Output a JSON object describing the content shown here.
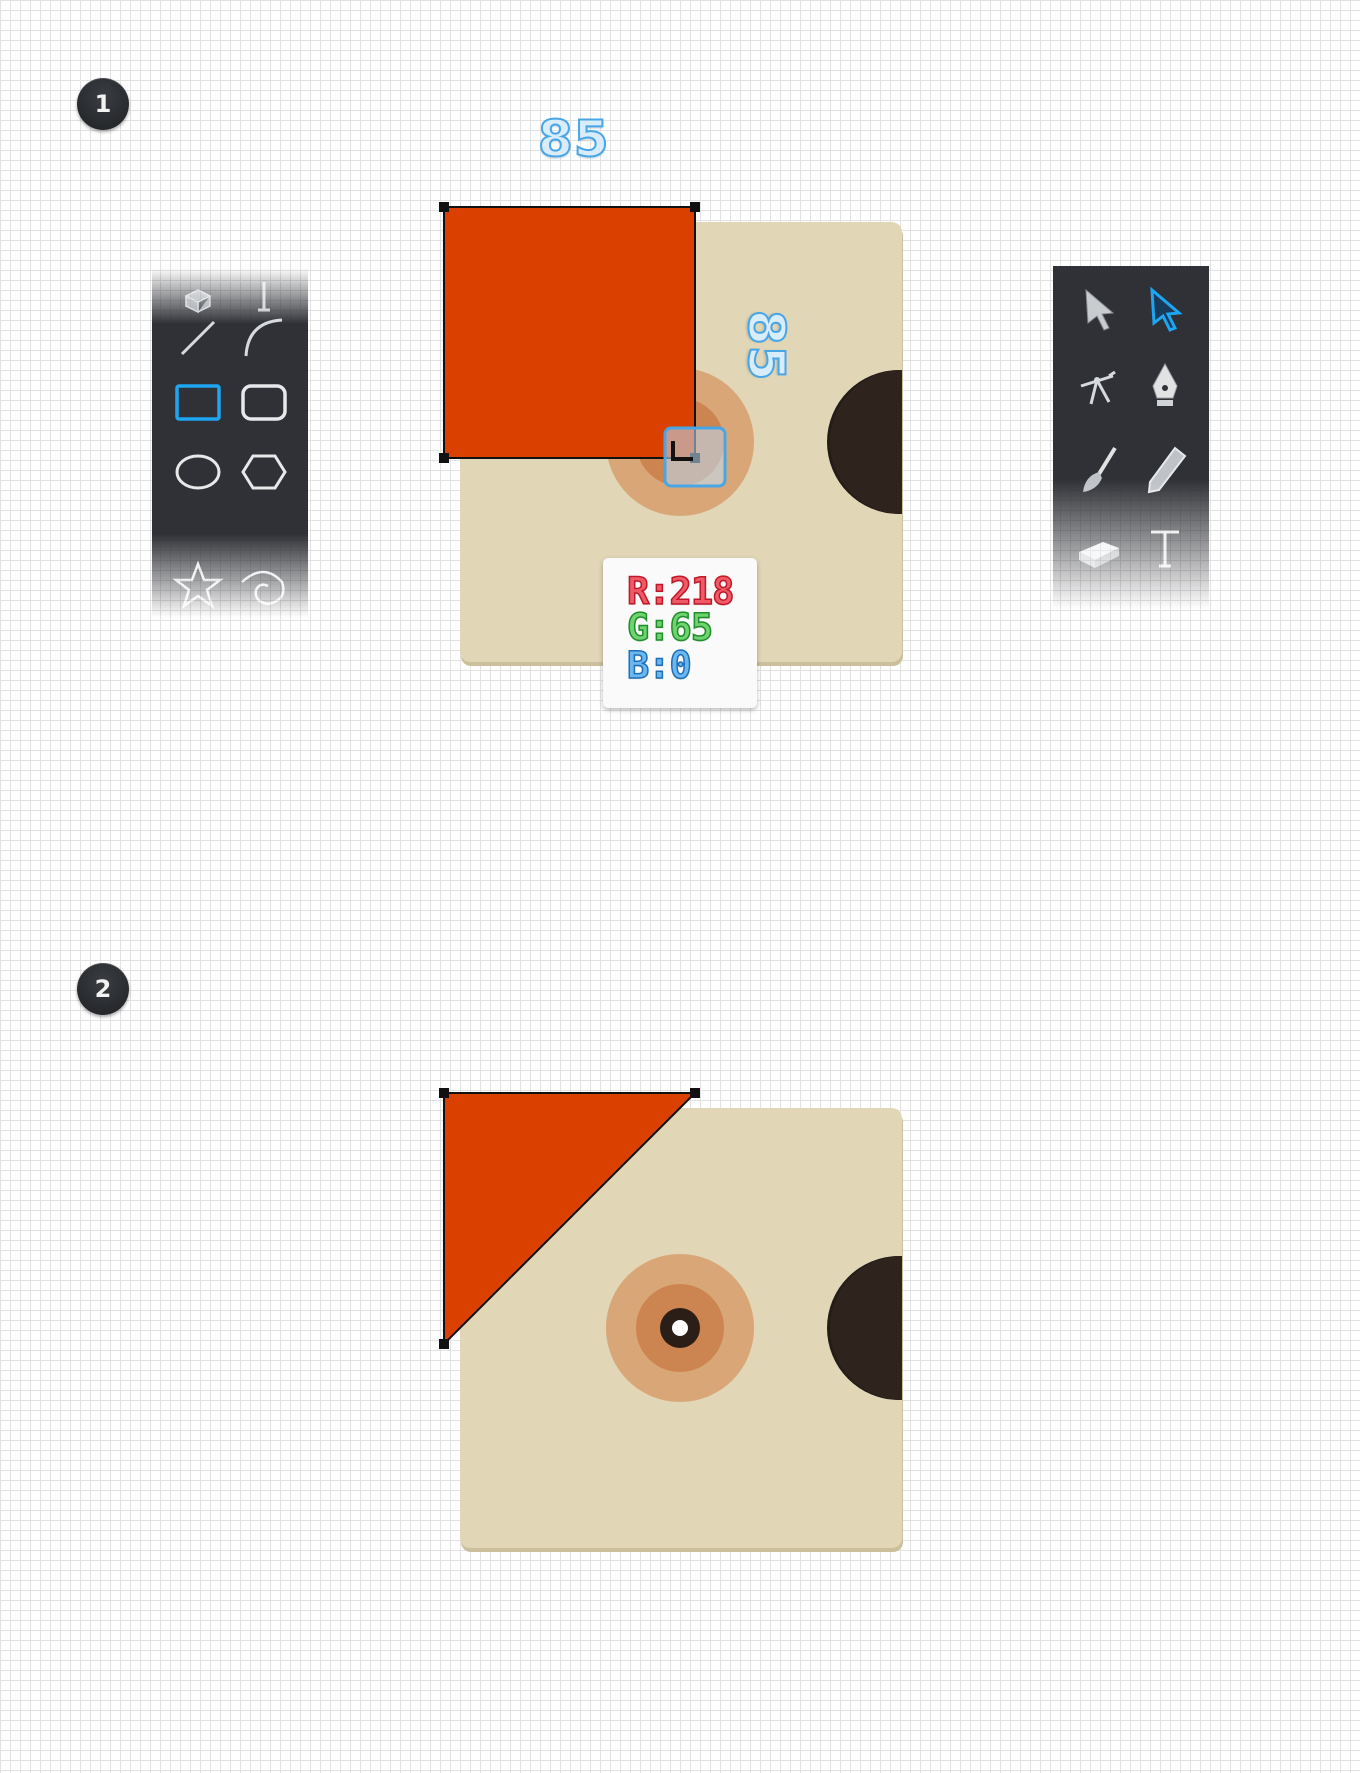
{
  "steps": {
    "step1_number": "1",
    "step2_number": "2"
  },
  "dimensions": {
    "width_label": "85",
    "height_label": "85"
  },
  "color_readout": {
    "r_label": "R:218",
    "g_label": "G:65",
    "b_label": "B:0",
    "swatch_color": "#da4100"
  },
  "colors": {
    "cover": "#e1d6b6",
    "cover_shadow": "#cbbf9c",
    "orange_shape": "#da4100",
    "disc_outer": "#d9a677",
    "disc_ring": "#cc8450",
    "disc_center": "#2a1e16",
    "record": "#231c17",
    "toolbar_bg": "#2f3136",
    "accent_blue": "#1ea6f2"
  },
  "left_toolbar": {
    "tools": [
      "3d-box-icon",
      "text-cursor-icon",
      "line-segment-icon",
      "arc-icon",
      "rectangle-icon",
      "rounded-rectangle-icon",
      "ellipse-icon",
      "polygon-icon",
      "star-icon",
      "spiral-icon"
    ],
    "selected": "rectangle-icon"
  },
  "right_toolbar": {
    "tools": [
      "selection-arrow-icon",
      "direct-selection-arrow-icon",
      "puppet-warp-icon",
      "pen-icon",
      "paintbrush-icon",
      "pencil-icon",
      "eraser-icon",
      "type-icon"
    ],
    "selected": "direct-selection-arrow-icon"
  }
}
